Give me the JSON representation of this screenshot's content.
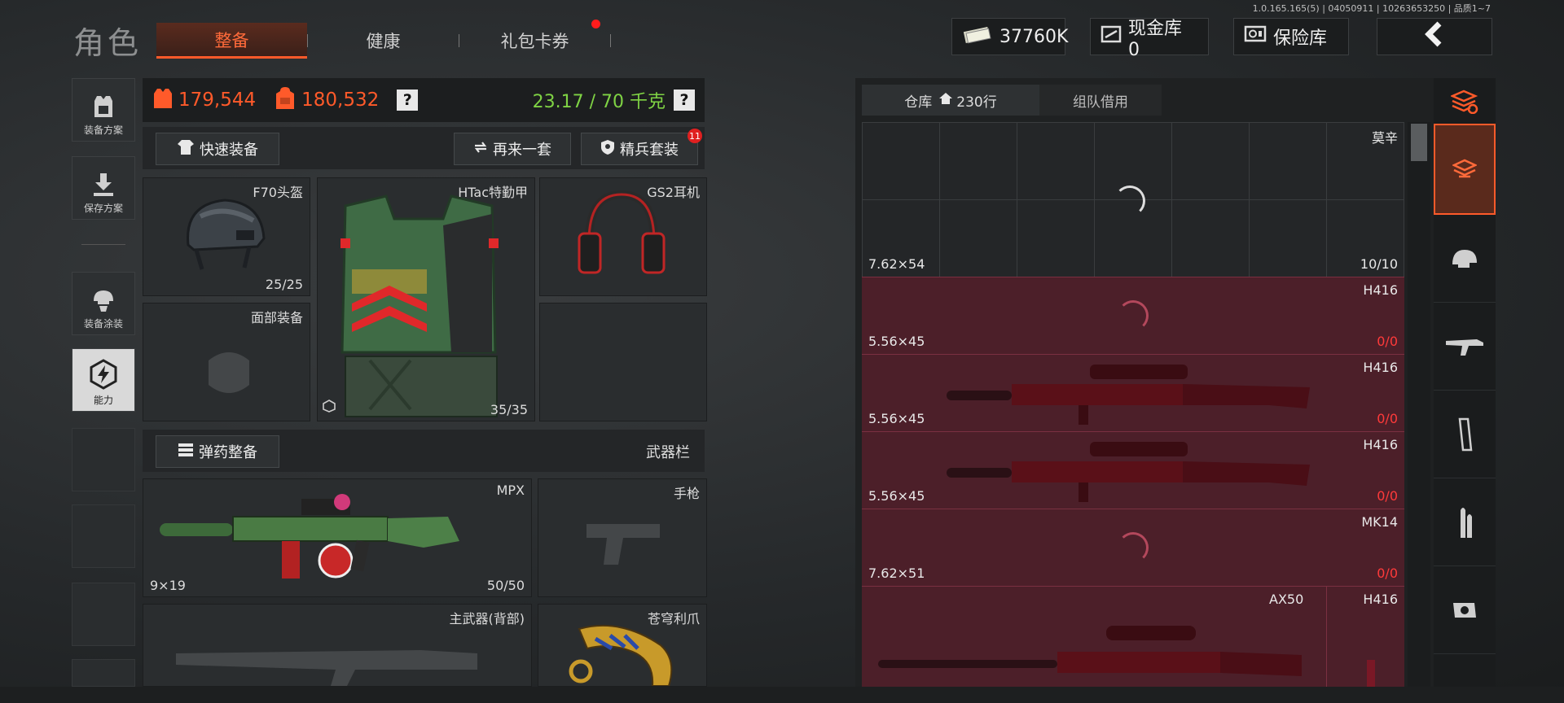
{
  "version": "1.0.165.165(5) | 04050911 | 10263653250 | 品质1~7",
  "page_title": "角色",
  "tabs": [
    {
      "label": "整备",
      "active": true
    },
    {
      "label": "健康",
      "active": false
    },
    {
      "label": "礼包卡券",
      "active": false,
      "notify_dot": true
    }
  ],
  "topbar": {
    "money": "37760K",
    "cash_vault": "现金库 0",
    "safe_box": "保险库",
    "back_icon": "back-chevron-icon"
  },
  "left_rail": [
    {
      "label": "装备方案",
      "icon": "armor-vest-icon"
    },
    {
      "label": "保存方案",
      "icon": "download-icon"
    },
    {
      "label": "装备涂装",
      "icon": "helmet-paint-icon"
    },
    {
      "label": "能力",
      "icon": "lightning-hex-icon"
    }
  ],
  "stats": {
    "armor_value": "179,544",
    "backpack_value": "180,532",
    "help": "?",
    "weight": "23.17 / 70 千克",
    "weight_help": "?"
  },
  "actions": {
    "quick_equip": "快速装备",
    "again": "再来一套",
    "elite_kit": "精兵套装",
    "elite_badge": "11",
    "ammo_equip": "弹药整备",
    "weapon_bar": "武器栏"
  },
  "gear": {
    "helmet": {
      "name": "F70头盔",
      "durability": "25/25"
    },
    "armor": {
      "name": "HTac特勤甲",
      "durability": "35/35"
    },
    "headset": {
      "name": "GS2耳机"
    },
    "face": {
      "name": "面部装备"
    },
    "primary": {
      "name": "MPX",
      "caliber": "9×19",
      "ammo": "50/50"
    },
    "pistol": {
      "name": "手枪"
    },
    "back_weapon": {
      "name": "主武器(背部)"
    },
    "melee": {
      "name": "苍穹利爪"
    }
  },
  "warehouse": {
    "tab_storage": "仓库",
    "rows_count": "230行",
    "tab_team": "组队借用",
    "rows": [
      {
        "name": "莫辛",
        "caliber": "7.62×54",
        "count": "10/10",
        "type": "plain",
        "loading": true
      },
      {
        "name": "H416",
        "caliber": "5.56×45",
        "count": "0/0",
        "type": "red",
        "loading": true
      },
      {
        "name": "H416",
        "caliber": "5.56×45",
        "count": "0/0",
        "type": "red"
      },
      {
        "name": "H416",
        "caliber": "5.56×45",
        "count": "0/0",
        "type": "red"
      },
      {
        "name": "MK14",
        "caliber": "7.62×51",
        "count": "0/0",
        "type": "red",
        "loading": true
      },
      {
        "name": "AX50",
        "name2": "H416",
        "type": "red"
      }
    ]
  },
  "categories": [
    "stack-refresh-icon",
    "stack-add-icon",
    "helmet-icon",
    "rifle-icon",
    "magazine-icon",
    "ammo-icon",
    "scope-icon"
  ],
  "colors": {
    "accent": "#ff5a2a",
    "weight_ok": "#7fd344",
    "danger": "#e02020",
    "row_red": "#4c1f29"
  }
}
